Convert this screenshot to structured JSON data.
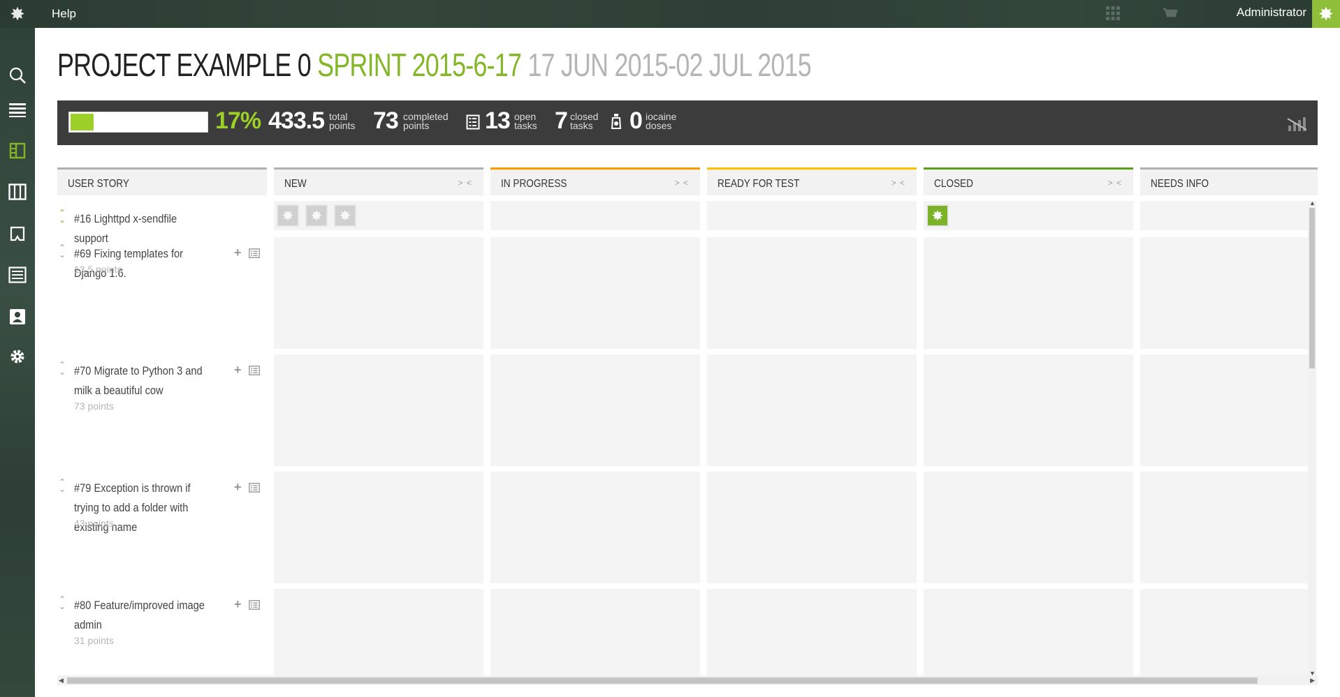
{
  "topbar": {
    "help_label": "Help",
    "user_name": "Administrator",
    "icons": [
      "taiga-logo-icon",
      "apps-grid-icon",
      "cart-icon",
      "avatar-icon"
    ]
  },
  "sidebar": {
    "items": [
      {
        "name": "search-icon"
      },
      {
        "name": "backlog-icon"
      },
      {
        "name": "taskboard-icon",
        "active": true
      },
      {
        "name": "kanban-icon"
      },
      {
        "name": "issues-icon"
      },
      {
        "name": "wiki-icon"
      },
      {
        "name": "team-icon"
      },
      {
        "name": "settings-icon"
      }
    ],
    "active_color": "#83b727"
  },
  "title": {
    "project": "PROJECT EXAMPLE 0",
    "sprint": "SPRINT 2015-6-17",
    "dates": "17 JUN 2015-02 JUL 2015"
  },
  "stats": {
    "progress_pct": 17,
    "progress_label": "17%",
    "total_points": "433.5",
    "total_points_label_1": "total",
    "total_points_label_2": "points",
    "completed_points": "73",
    "completed_points_label_1": "completed",
    "completed_points_label_2": "points",
    "open_tasks": "13",
    "open_tasks_label_1": "open",
    "open_tasks_label_2": "tasks",
    "closed_tasks": "7",
    "closed_tasks_label_1": "closed",
    "closed_tasks_label_2": "tasks",
    "iocaine_doses": "0",
    "iocaine_label_1": "iocaine",
    "iocaine_label_2": "doses"
  },
  "board": {
    "user_story_header": "USER STORY",
    "fold_label": "> <",
    "columns": [
      {
        "label": "NEW",
        "color": "#b0b0b0"
      },
      {
        "label": "IN PROGRESS",
        "color": "#ff9900"
      },
      {
        "label": "READY FOR TEST",
        "color": "#fcc000"
      },
      {
        "label": "CLOSED",
        "color": "#5a9e1a"
      },
      {
        "label": "NEEDS INFO",
        "color": "#b0b0b0"
      }
    ],
    "stories": [
      {
        "text": "#16 Lighttpd x-sendfile support",
        "points": ""
      },
      {
        "text": "#69 Fixing templates for Django 1.6.",
        "points": "13.5 points"
      },
      {
        "text": "#70 Migrate to Python 3 and milk a beautiful cow",
        "points": "73 points"
      },
      {
        "text": "#79 Exception is thrown if trying to add a folder with existing name",
        "points": "43 points"
      },
      {
        "text": "#80 Feature/improved image admin",
        "points": "31 points"
      }
    ]
  }
}
